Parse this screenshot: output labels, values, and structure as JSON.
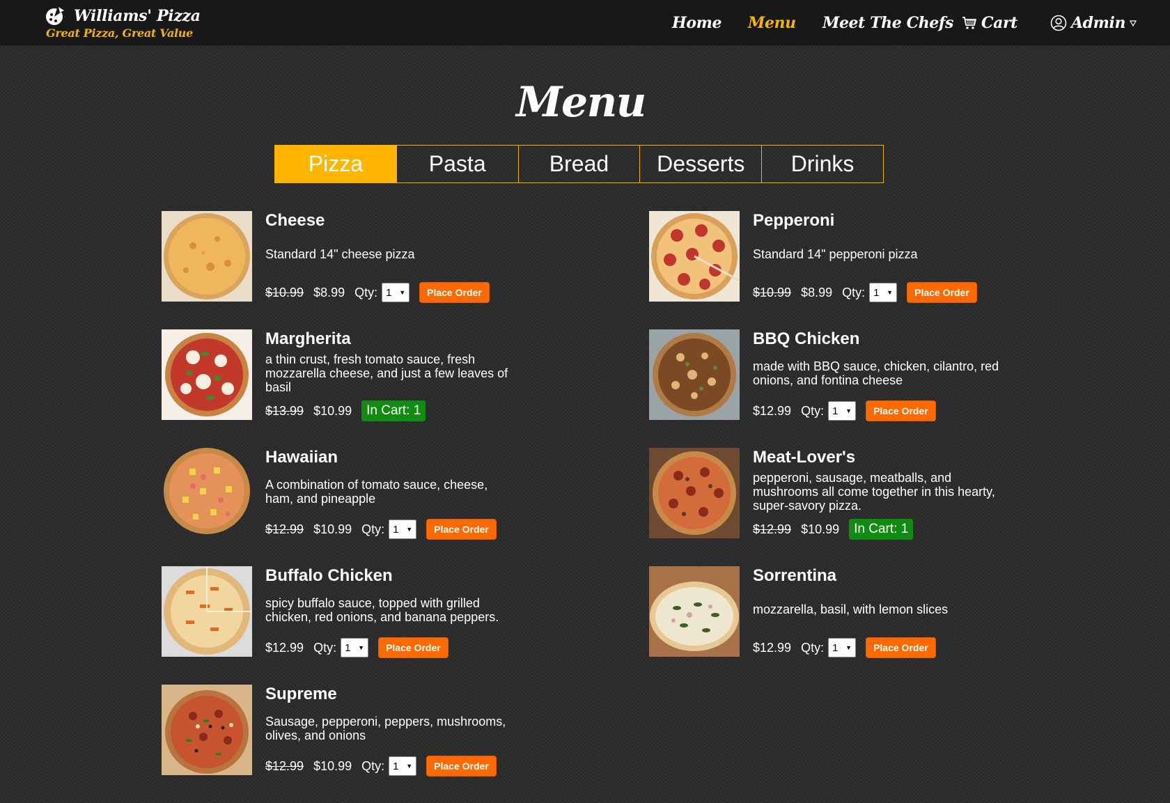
{
  "nav": {
    "brand_name": "Williams' Pizza",
    "brand_tagline": "Great Pizza, Great Value",
    "links": [
      "Home",
      "Menu",
      "Meet The Chefs",
      "Cart",
      "Admin"
    ],
    "active": "Menu"
  },
  "page": {
    "title": "Menu"
  },
  "tabs": [
    {
      "label": "Pizza",
      "active": true
    },
    {
      "label": "Pasta",
      "active": false
    },
    {
      "label": "Bread",
      "active": false
    },
    {
      "label": "Desserts",
      "active": false
    },
    {
      "label": "Drinks",
      "active": false
    }
  ],
  "labels": {
    "qty": "Qty:",
    "place_order": "Place Order"
  },
  "colors": {
    "accent": "#ffb400",
    "order_button": "#ff6a00",
    "in_cart": "#118b11",
    "navbar": "#181818"
  },
  "items": [
    {
      "name": "Cheese",
      "description": "Standard 14\" cheese pizza",
      "old_price": "$10.99",
      "price": "$8.99",
      "qty": "1",
      "action": "Place Order",
      "image": "cheese-pizza"
    },
    {
      "name": "Pepperoni",
      "description": "Standard 14\" pepperoni pizza",
      "old_price": "$10.99",
      "price": "$8.99",
      "qty": "1",
      "action": "Place Order",
      "image": "pepperoni-pizza"
    },
    {
      "name": "Margherita",
      "description": "a thin crust, fresh tomato sauce, fresh mozzarella cheese, and just a few leaves of basil",
      "old_price": "$13.99",
      "price": "$10.99",
      "in_cart": "In Cart: 1",
      "image": "margherita-pizza"
    },
    {
      "name": "BBQ Chicken",
      "description": "made with BBQ sauce, chicken, cilantro, red onions, and fontina cheese",
      "price": "$12.99",
      "qty": "1",
      "action": "Place Order",
      "image": "bbq-chicken-pizza"
    },
    {
      "name": "Hawaiian",
      "description": "A combination of tomato sauce, cheese, ham, and pineapple",
      "old_price": "$12.99",
      "price": "$10.99",
      "qty": "1",
      "action": "Place Order",
      "image": "hawaiian-pizza"
    },
    {
      "name": "Meat-Lover's",
      "description": "pepperoni, sausage, meatballs, and mushrooms all come together in this hearty, super-savory pizza.",
      "old_price": "$12.99",
      "price": "$10.99",
      "in_cart": "In Cart: 1",
      "image": "meat-lovers-pizza"
    },
    {
      "name": "Buffalo Chicken",
      "description": "spicy buffalo sauce, topped with grilled chicken, red onions, and banana peppers.",
      "price": "$12.99",
      "qty": "1",
      "action": "Place Order",
      "image": "buffalo-chicken-pizza"
    },
    {
      "name": "Sorrentina",
      "description": "mozzarella, basil, with lemon slices",
      "price": "$12.99",
      "qty": "1",
      "action": "Place Order",
      "image": "sorrentina-pizza"
    },
    {
      "name": "Supreme",
      "description": "Sausage, pepperoni, peppers, mushrooms, olives, and onions",
      "old_price": "$12.99",
      "price": "$10.99",
      "qty": "1",
      "action": "Place Order",
      "image": "supreme-pizza"
    }
  ]
}
